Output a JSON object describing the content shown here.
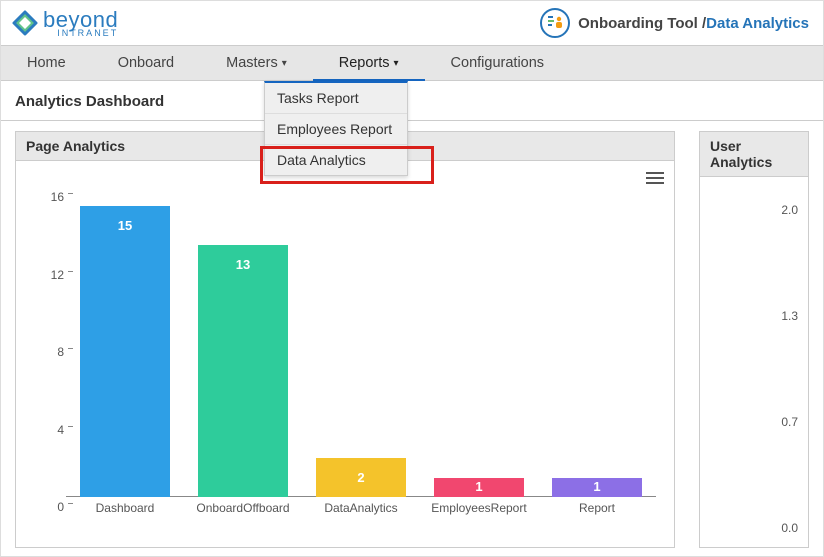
{
  "brand": {
    "word": "beyond",
    "sub": "INTRANET"
  },
  "breadcrumb": {
    "app": "Onboarding Tool",
    "sep": " /",
    "page": "Data Analytics"
  },
  "nav": {
    "home": "Home",
    "onboard": "Onboard",
    "masters": "Masters",
    "reports": "Reports",
    "config": "Configurations"
  },
  "reports_menu": {
    "tasks": "Tasks Report",
    "employees": "Employees Report",
    "data": "Data Analytics"
  },
  "page_title": "Analytics Dashboard",
  "panel1_title": "Page Analytics",
  "panel2_title": "User Analytics",
  "chart_data": {
    "type": "bar",
    "title": "Page Analytics",
    "categories": [
      "Dashboard",
      "OnboardOffboard",
      "DataAnalytics",
      "EmployeesReport",
      "Report"
    ],
    "values": [
      15,
      13,
      2,
      1,
      1
    ],
    "colors": [
      "#2E9FE6",
      "#2ECC9B",
      "#F4C32B",
      "#F1476F",
      "#8C6FE6"
    ],
    "ylim": [
      0,
      16
    ],
    "yticks": [
      0,
      4,
      8,
      12,
      16
    ],
    "xlabel": "",
    "ylabel": ""
  },
  "panel2_ticks": [
    "2.0",
    "1.3",
    "0.7",
    "0.0"
  ]
}
